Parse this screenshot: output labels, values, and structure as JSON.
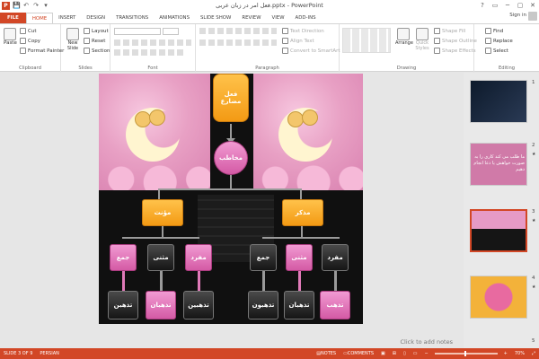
{
  "titlebar": {
    "title": "فعل امر در زبان عربی.pptx - PowerPoint",
    "app_letter": "P",
    "qat": [
      "💾",
      "↶",
      "↷",
      "▾"
    ],
    "controls": [
      "?",
      "▭",
      "─",
      "▢",
      "✕"
    ]
  },
  "tabs": [
    "FILE",
    "HOME",
    "INSERT",
    "DESIGN",
    "TRANSITIONS",
    "ANIMATIONS",
    "SLIDE SHOW",
    "REVIEW",
    "VIEW",
    "ADD-INS"
  ],
  "signin": "Sign in",
  "ribbon": {
    "clipboard": {
      "label": "Clipboard",
      "paste": "Paste",
      "cut": "Cut",
      "copy": "Copy",
      "format_painter": "Format Painter"
    },
    "slides": {
      "label": "Slides",
      "new_slide": "New Slide",
      "layout": "Layout",
      "reset": "Reset",
      "section": "Section"
    },
    "font": {
      "label": "Font"
    },
    "paragraph": {
      "label": "Paragraph",
      "text_direction": "Text Direction",
      "align_text": "Align Text",
      "convert": "Convert to SmartArt"
    },
    "drawing": {
      "label": "Drawing",
      "arrange": "Arrange",
      "quick_styles": "Quick Styles",
      "shape_fill": "Shape Fill",
      "shape_outline": "Shape Outline",
      "shape_effects": "Shape Effects"
    },
    "editing": {
      "label": "Editing",
      "find": "Find",
      "replace": "Replace",
      "select": "Select"
    }
  },
  "slide": {
    "top": "فعل مضارع",
    "mid": "مخاطب",
    "left_head": "مؤنث",
    "right_head": "مذكر",
    "left_row1": [
      "جمع",
      "مثنی",
      "مفرد"
    ],
    "right_row1": [
      "جمع",
      "مثنی",
      "مفرد"
    ],
    "left_row2": [
      "تذهبن",
      "تذهبان",
      "تذهبین"
    ],
    "right_row2": [
      "تذهبون",
      "تذهبان",
      "تذهب"
    ]
  },
  "notes_placeholder": "Click to add notes",
  "thumbnails": {
    "numbers": [
      "1",
      "2",
      "3",
      "4",
      "5"
    ],
    "slide2_text": "ما طلب می کند کاری را به صورت خواهش یا دعا انجام دهیم"
  },
  "status": {
    "slide": "SLIDE 3 OF 9",
    "lang": "PERSIAN",
    "notes": "NOTES",
    "comments": "COMMENTS",
    "zoom": "70%",
    "zoom_fraction": 0.7
  }
}
